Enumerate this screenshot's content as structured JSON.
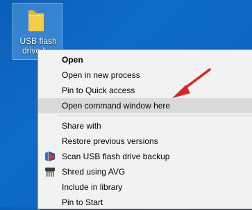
{
  "desktop": {
    "icon_label": "USB flash drive b..."
  },
  "context_menu": {
    "items": [
      {
        "label": "Open"
      },
      {
        "label": "Open in new process"
      },
      {
        "label": "Pin to Quick access"
      },
      {
        "label": "Open command window here"
      },
      {
        "label": "Share with"
      },
      {
        "label": "Restore previous versions"
      },
      {
        "label": "Scan USB flash drive backup"
      },
      {
        "label": "Shred using AVG"
      },
      {
        "label": "Include in library"
      },
      {
        "label": "Pin to Start"
      }
    ]
  },
  "colors": {
    "desktop_background": "#0b63bd",
    "menu_background": "#f2f2f2",
    "highlight": "#dadada",
    "annotation_arrow": "#e0211c"
  },
  "icons": {
    "folder": "folder-icon",
    "scan": "malwarebytes-icon",
    "shred": "shredder-icon",
    "annotation": "red-arrow-icon"
  }
}
